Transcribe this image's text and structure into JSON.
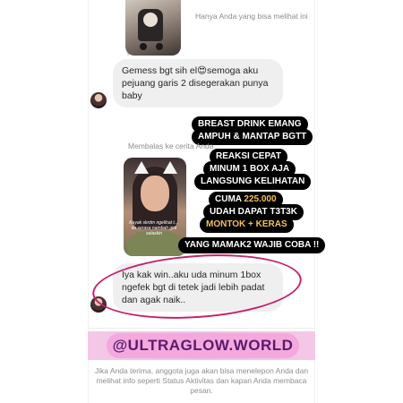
{
  "thread": {
    "top_note": "Hanya Anda yang bisa melihat ini",
    "message_1": "Gemess bgt sih el😍semoga aku pejuang garis 2 disegerakan punya baby",
    "reply_label": "Membalas ke cerita Anda",
    "story_caption": "Kayak skrdm ngelihat t… itu serasa nambah gini selaskin",
    "message_2": "Iya kak win..aku uda minum 1box ngefek bgt di tetek jadi lebih padat dan agak naik.."
  },
  "overlay": {
    "line_1": "BREAST DRINK EMANG",
    "line_2": "AMPUH & MANTAP BGTT",
    "line_3": "REAKSI CEPAT",
    "line_4": "MINUM 1 BOX AJA",
    "line_5": "LANGSUNG KELIHATAN",
    "price_prefix": "CUMA ",
    "price": "225.000",
    "line_7": "UDAH DAPAT T3T3K",
    "line_8": "MONTOK + KERAS",
    "line_9": "YANG MAMAK2 WAJIB COBA !!"
  },
  "promo": {
    "handle": "@ULTRAGLOW.WORLD"
  },
  "footer": {
    "text": "Jika Anda terima, anggota juga akan bisa menelepon Anda dan melihat info seperti Status Aktivitas dan kapan Anda membaca pesan."
  },
  "colors": {
    "annotation": "#c4226e",
    "price_gold": "#f0c060",
    "promo_pink": "#f3a9dc"
  }
}
